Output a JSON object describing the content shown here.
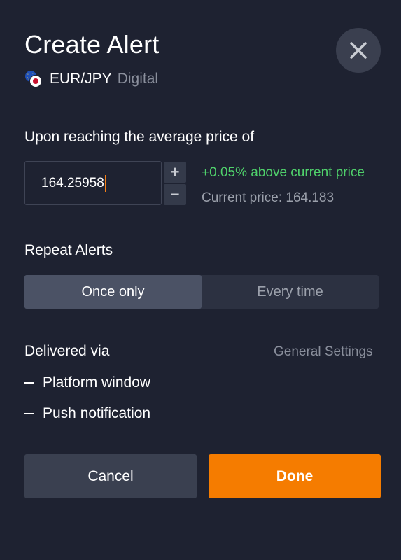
{
  "dialog": {
    "title": "Create Alert",
    "close_icon": "close-icon"
  },
  "asset": {
    "name": "EUR/JPY",
    "type": "Digital",
    "icon": "eur-jpy-flag-icon"
  },
  "price_alert": {
    "label": "Upon reaching the average price of",
    "input_value": "164.25958",
    "increment_symbol": "+",
    "decrement_symbol": "−",
    "change_text": "+0.05% above current price",
    "current_price_label": "Current price:",
    "current_price_value": "164.183"
  },
  "repeat": {
    "label": "Repeat Alerts",
    "options": [
      "Once only",
      "Every time"
    ],
    "selected": "Once only"
  },
  "delivery": {
    "label": "Delivered via",
    "settings_link": "General Settings",
    "methods": [
      "Platform window",
      "Push notification"
    ]
  },
  "actions": {
    "cancel_label": "Cancel",
    "done_label": "Done"
  },
  "colors": {
    "background": "#1e2231",
    "accent": "#f57c00",
    "positive": "#4fd06b",
    "muted": "#8a8f9c"
  }
}
